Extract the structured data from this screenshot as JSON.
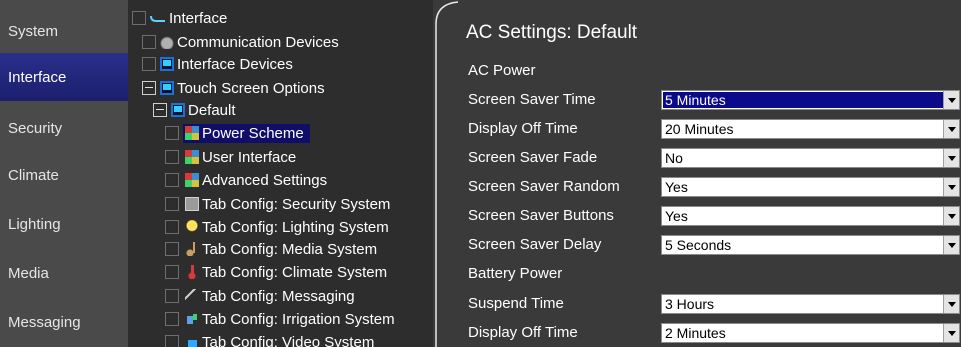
{
  "nav": {
    "items": [
      {
        "label": "System"
      },
      {
        "label": "Interface",
        "active": true
      },
      {
        "label": "Security"
      },
      {
        "label": "Climate"
      },
      {
        "label": "Lighting"
      },
      {
        "label": "Media"
      },
      {
        "label": "Messaging"
      }
    ]
  },
  "tree": {
    "items": [
      {
        "label": "Interface",
        "icon": "connector-icon"
      },
      {
        "label": "Communication Devices",
        "icon": "communication-devices-icon"
      },
      {
        "label": "Interface Devices",
        "icon": "touch-screen-icon"
      },
      {
        "label": "Touch Screen Options",
        "icon": "touch-screen-icon",
        "expanded": true
      },
      {
        "label": "Default",
        "icon": "touch-screen-icon",
        "expanded": true
      },
      {
        "label": "Power Scheme",
        "icon": "color-quad-icon",
        "selected": true
      },
      {
        "label": "User Interface",
        "icon": "color-quad-icon"
      },
      {
        "label": "Advanced Settings",
        "icon": "color-quad-icon"
      },
      {
        "label": "Tab Config: Security System",
        "icon": "security-panel-icon"
      },
      {
        "label": "Tab Config: Lighting System",
        "icon": "light-bulb-icon"
      },
      {
        "label": "Tab Config: Media System",
        "icon": "music-note-icon"
      },
      {
        "label": "Tab Config: Climate System",
        "icon": "thermometer-icon"
      },
      {
        "label": "Tab Config: Messaging",
        "icon": "pen-icon"
      },
      {
        "label": "Tab Config: Irrigation System",
        "icon": "sprinkler-icon"
      },
      {
        "label": "Tab Config: Video System",
        "icon": "video-icon"
      }
    ]
  },
  "settings": {
    "title": "AC Settings: Default",
    "ac_power_header": "AC Power",
    "battery_power_header": "Battery Power",
    "rows": [
      {
        "label": "Screen Saver Time",
        "value": "5 Minutes",
        "focused": true
      },
      {
        "label": "Display Off Time",
        "value": "20 Minutes"
      },
      {
        "label": "Screen Saver Fade",
        "value": "No"
      },
      {
        "label": "Screen Saver Random",
        "value": "Yes"
      },
      {
        "label": "Screen Saver Buttons",
        "value": "Yes"
      },
      {
        "label": "Screen Saver Delay",
        "value": "5 Seconds"
      },
      {
        "label": "Suspend Time",
        "value": "3 Hours"
      },
      {
        "label": "Display Off Time",
        "value": "2 Minutes"
      }
    ]
  },
  "colors": {
    "nav_active": "#1c1f6e",
    "selection": "#0f0f6a",
    "focused_value": "#0a0a8a"
  }
}
